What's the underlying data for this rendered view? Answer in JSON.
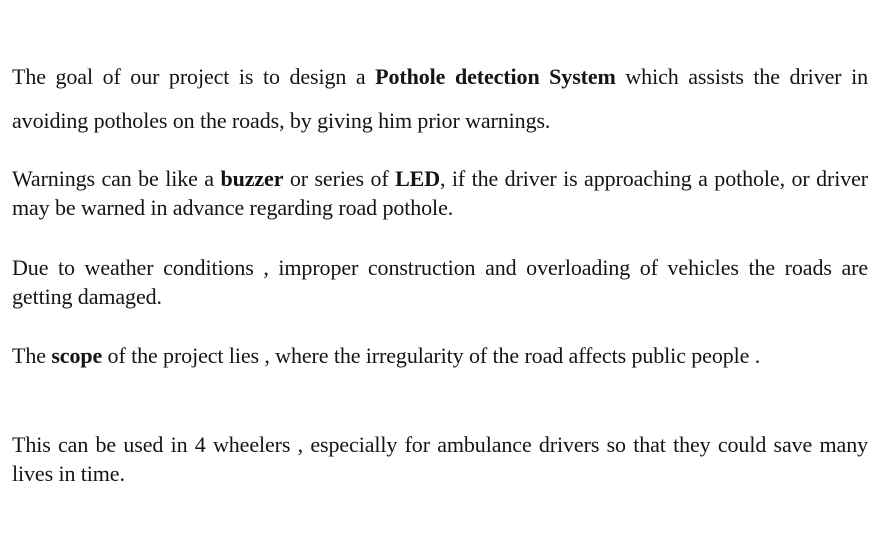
{
  "document": {
    "paragraphs": [
      {
        "segments": [
          {
            "text": "The goal of our project is to design a ",
            "bold": false
          },
          {
            "text": "Pothole detection System",
            "bold": true
          },
          {
            "text": " which assists the driver in avoiding potholes on the roads, by giving him prior warnings.",
            "bold": false
          }
        ]
      },
      {
        "segments": [
          {
            "text": "Warnings can be like a ",
            "bold": false
          },
          {
            "text": "buzzer",
            "bold": true
          },
          {
            "text": " or series of ",
            "bold": false
          },
          {
            "text": "LED",
            "bold": true
          },
          {
            "text": ", if the driver is approaching a pothole, or driver may be warned in advance regarding road pothole.",
            "bold": false
          }
        ]
      },
      {
        "segments": [
          {
            "text": "Due to weather conditions , improper construction and overloading of vehicles the roads are getting damaged.",
            "bold": false
          }
        ]
      },
      {
        "segments": [
          {
            "text": "The ",
            "bold": false
          },
          {
            "text": "scope",
            "bold": true
          },
          {
            "text": " of the project lies , where the irregularity of the road affects public people .",
            "bold": false
          }
        ]
      },
      {
        "segments": [
          {
            "text": "This can be used in 4 wheelers , especially for ambulance drivers so that they could save many lives in time.",
            "bold": false
          }
        ]
      }
    ]
  }
}
